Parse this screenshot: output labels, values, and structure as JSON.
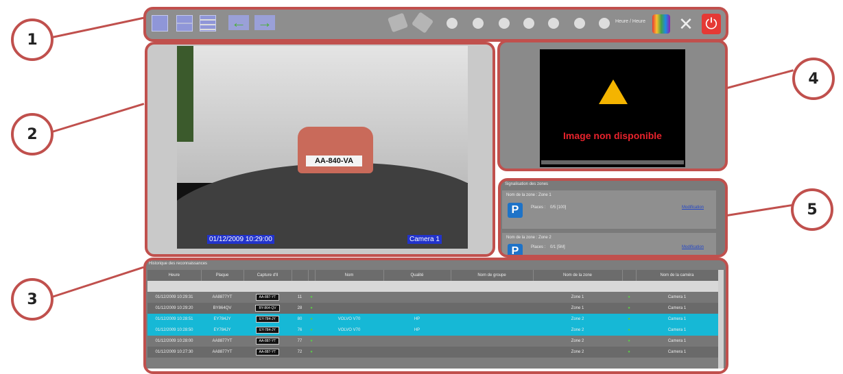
{
  "callouts": [
    "1",
    "2",
    "3",
    "4",
    "5"
  ],
  "toolbar": {
    "icons": [
      "layout-single-icon",
      "layout-grid-icon",
      "layout-list-icon",
      "arrow-left-icon",
      "arrow-right-icon",
      "search-tag-icon",
      "tag-icon",
      "skip-back-icon",
      "prev-icon",
      "rewind-icon",
      "pause-icon",
      "play-icon",
      "next-icon",
      "skip-forward-icon",
      "palette-icon",
      "tools-icon",
      "power-icon"
    ],
    "time_label": "Heure / Heure"
  },
  "video": {
    "plate_text": "AA-840-VA",
    "timestamp": "01/12/2009 10:29:00",
    "camera_label": "Camera 1"
  },
  "panel4": {
    "title": "Image non disponible"
  },
  "panel5": {
    "header": "Signalisation des zones",
    "zones": [
      {
        "name": "Nom de la zone : Zone 1",
        "places_label": "Places :",
        "places_value": "0/5 [100]",
        "link": "Modification"
      },
      {
        "name": "Nom de la zone : Zone 2",
        "places_label": "Places :",
        "places_value": "0/1 [5M]",
        "link": "Modification"
      }
    ]
  },
  "panel3": {
    "title": "Historique des reconnaissances",
    "columns": [
      "Heure",
      "Plaque",
      "Capture d'Il",
      "",
      "",
      "Nom",
      "Qualité",
      "Nom de groupe",
      "Nom de la zone",
      "",
      "Nom de la caméra"
    ],
    "rows": [
      {
        "time": "01/12/2009 10:29:31",
        "plate": "AA8877YT",
        "capture": "AA-887-YT",
        "n": "11",
        "nom": "",
        "qualite": "",
        "groupe": "",
        "zone": "Zone 1",
        "camera": "Camera 1",
        "highlight": false
      },
      {
        "time": "01/12/2009 10:29:20",
        "plate": "BY864QV",
        "capture": "BY-864-QV",
        "n": "28",
        "nom": "",
        "qualite": "",
        "groupe": "",
        "zone": "Zone 1",
        "camera": "Camera 1",
        "highlight": false
      },
      {
        "time": "01/12/2009 10:28:51",
        "plate": "EY784JY",
        "capture": "EY-784-JY",
        "n": "80",
        "nom": "VOLVO V70",
        "qualite": "HP",
        "groupe": "",
        "zone": "Zone 2",
        "camera": "Camera 1",
        "highlight": true
      },
      {
        "time": "01/12/2009 10:28:50",
        "plate": "EY784JY",
        "capture": "EY-784-JY",
        "n": "76",
        "nom": "VOLVO V70",
        "qualite": "HP",
        "groupe": "",
        "zone": "Zone 2",
        "camera": "Camera 1",
        "highlight": true
      },
      {
        "time": "01/12/2009 10:28:00",
        "plate": "AA8877YT",
        "capture": "AA-887-YT",
        "n": "77",
        "nom": "",
        "qualite": "",
        "groupe": "",
        "zone": "Zone 2",
        "camera": "Camera 1",
        "highlight": false
      },
      {
        "time": "01/12/2009 10:27:30",
        "plate": "AA8877YT",
        "capture": "AA-887-YT",
        "n": "72",
        "nom": "",
        "qualite": "",
        "groupe": "",
        "zone": "Zone 2",
        "camera": "Camera 1",
        "highlight": false
      }
    ]
  }
}
